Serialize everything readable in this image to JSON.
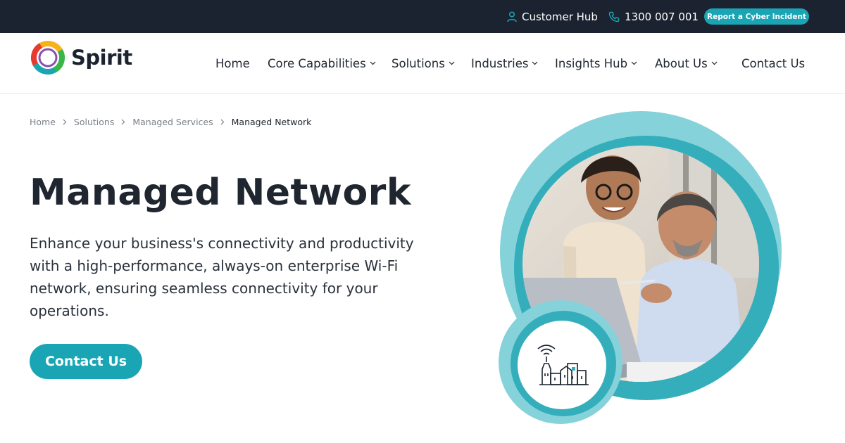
{
  "topbar": {
    "customer_hub": "Customer Hub",
    "phone": "1300 007 001",
    "report_button": "Report a Cyber Incident",
    "icons": {
      "hub": "user-icon",
      "phone": "phone-icon"
    }
  },
  "brand": {
    "name": "Spirit",
    "logo_icon": "spirit-ring-logo"
  },
  "nav": {
    "items": [
      {
        "label": "Home",
        "dropdown": false
      },
      {
        "label": "Core Capabilities",
        "dropdown": true
      },
      {
        "label": "Solutions",
        "dropdown": true
      },
      {
        "label": "Industries",
        "dropdown": true
      },
      {
        "label": "Insights Hub",
        "dropdown": true
      },
      {
        "label": "About Us",
        "dropdown": true
      },
      {
        "label": "Contact Us",
        "dropdown": false
      }
    ]
  },
  "breadcrumb": [
    "Home",
    "Solutions",
    "Managed Services",
    "Managed Network"
  ],
  "hero": {
    "title": "Managed Network",
    "description": "Enhance your business's connectivity and productivity with a high-performance, always-on enterprise Wi-Fi network, ensuring seamless connectivity for your operations.",
    "cta_label": "Contact Us",
    "image_icon": "smart-city-wifi-icon"
  },
  "colors": {
    "topbar_bg": "#1c2330",
    "accent": "#1aa5b5",
    "accent_light": "#7fd0d8",
    "text": "#1f2630"
  }
}
